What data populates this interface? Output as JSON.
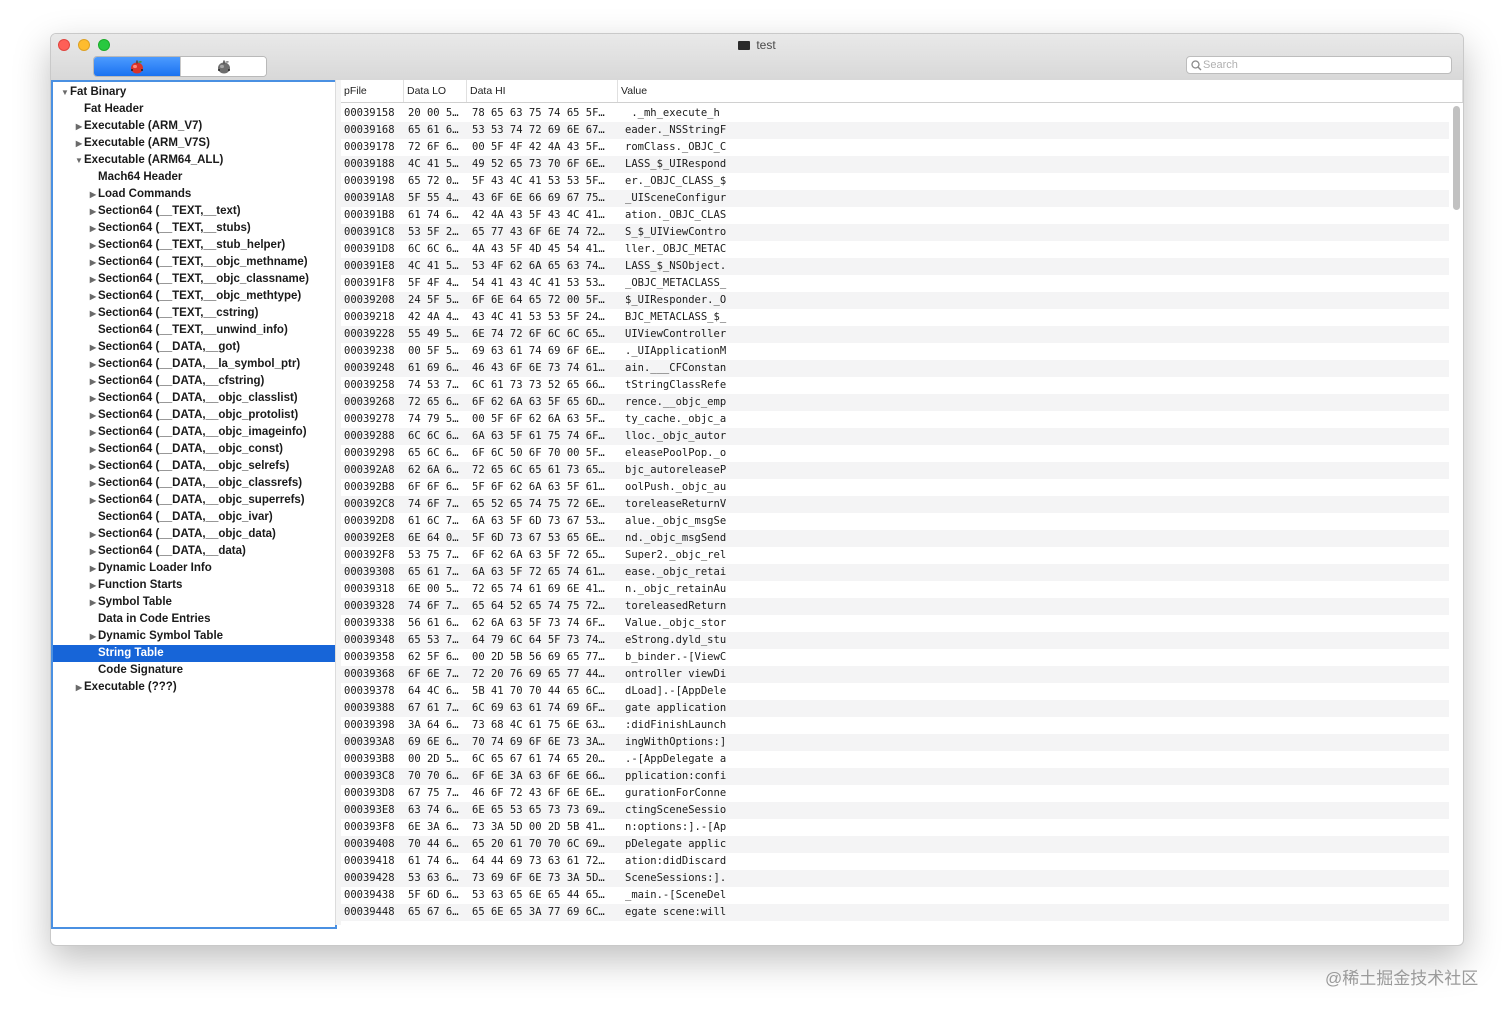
{
  "window": {
    "title": "test",
    "search_placeholder": "Search",
    "segments": [
      {
        "icon": "colored-apple-bug-icon",
        "active": true
      },
      {
        "icon": "gray-apple-bug-icon",
        "active": false
      }
    ]
  },
  "sidebar": {
    "items": [
      {
        "label": "Fat Binary",
        "depth": 0,
        "disclosure": "open"
      },
      {
        "label": "Fat Header",
        "depth": 1,
        "disclosure": "none"
      },
      {
        "label": "Executable  (ARM_V7)",
        "depth": 1,
        "disclosure": "closed"
      },
      {
        "label": "Executable  (ARM_V7S)",
        "depth": 1,
        "disclosure": "closed"
      },
      {
        "label": "Executable  (ARM64_ALL)",
        "depth": 1,
        "disclosure": "open"
      },
      {
        "label": "Mach64 Header",
        "depth": 2,
        "disclosure": "none"
      },
      {
        "label": "Load Commands",
        "depth": 2,
        "disclosure": "closed"
      },
      {
        "label": "Section64 (__TEXT,__text)",
        "depth": 2,
        "disclosure": "closed"
      },
      {
        "label": "Section64 (__TEXT,__stubs)",
        "depth": 2,
        "disclosure": "closed"
      },
      {
        "label": "Section64 (__TEXT,__stub_helper)",
        "depth": 2,
        "disclosure": "closed"
      },
      {
        "label": "Section64 (__TEXT,__objc_methname)",
        "depth": 2,
        "disclosure": "closed"
      },
      {
        "label": "Section64 (__TEXT,__objc_classname)",
        "depth": 2,
        "disclosure": "closed"
      },
      {
        "label": "Section64 (__TEXT,__objc_methtype)",
        "depth": 2,
        "disclosure": "closed"
      },
      {
        "label": "Section64 (__TEXT,__cstring)",
        "depth": 2,
        "disclosure": "closed"
      },
      {
        "label": "Section64 (__TEXT,__unwind_info)",
        "depth": 2,
        "disclosure": "none"
      },
      {
        "label": "Section64 (__DATA,__got)",
        "depth": 2,
        "disclosure": "closed"
      },
      {
        "label": "Section64 (__DATA,__la_symbol_ptr)",
        "depth": 2,
        "disclosure": "closed"
      },
      {
        "label": "Section64 (__DATA,__cfstring)",
        "depth": 2,
        "disclosure": "closed"
      },
      {
        "label": "Section64 (__DATA,__objc_classlist)",
        "depth": 2,
        "disclosure": "closed"
      },
      {
        "label": "Section64 (__DATA,__objc_protolist)",
        "depth": 2,
        "disclosure": "closed"
      },
      {
        "label": "Section64 (__DATA,__objc_imageinfo)",
        "depth": 2,
        "disclosure": "closed"
      },
      {
        "label": "Section64 (__DATA,__objc_const)",
        "depth": 2,
        "disclosure": "closed"
      },
      {
        "label": "Section64 (__DATA,__objc_selrefs)",
        "depth": 2,
        "disclosure": "closed"
      },
      {
        "label": "Section64 (__DATA,__objc_classrefs)",
        "depth": 2,
        "disclosure": "closed"
      },
      {
        "label": "Section64 (__DATA,__objc_superrefs)",
        "depth": 2,
        "disclosure": "closed"
      },
      {
        "label": "Section64 (__DATA,__objc_ivar)",
        "depth": 2,
        "disclosure": "none"
      },
      {
        "label": "Section64 (__DATA,__objc_data)",
        "depth": 2,
        "disclosure": "closed"
      },
      {
        "label": "Section64 (__DATA,__data)",
        "depth": 2,
        "disclosure": "closed"
      },
      {
        "label": "Dynamic Loader Info",
        "depth": 2,
        "disclosure": "closed"
      },
      {
        "label": "Function Starts",
        "depth": 2,
        "disclosure": "closed"
      },
      {
        "label": "Symbol Table",
        "depth": 2,
        "disclosure": "closed"
      },
      {
        "label": "Data in Code Entries",
        "depth": 2,
        "disclosure": "none"
      },
      {
        "label": "Dynamic Symbol Table",
        "depth": 2,
        "disclosure": "closed"
      },
      {
        "label": "String Table",
        "depth": 2,
        "disclosure": "none",
        "selected": true
      },
      {
        "label": "Code Signature",
        "depth": 2,
        "disclosure": "none"
      },
      {
        "label": "Executable  (???)",
        "depth": 1,
        "disclosure": "closed"
      }
    ]
  },
  "table": {
    "columns": [
      "pFile",
      "Data LO",
      "Data HI",
      "Value"
    ],
    "rows": [
      [
        "00039158",
        "20 00 5…",
        "78 65 63 75 74 65 5F…",
        " ._mh_execute_h"
      ],
      [
        "00039168",
        "65 61 6…",
        "53 53 74 72 69 6E 67…",
        "eader._NSStringF"
      ],
      [
        "00039178",
        "72 6F 6…",
        "00 5F 4F 42 4A 43 5F…",
        "romClass._OBJC_C"
      ],
      [
        "00039188",
        "4C 41 5…",
        "49 52 65 73 70 6F 6E…",
        "LASS_$_UIRespond"
      ],
      [
        "00039198",
        "65 72 0…",
        "5F 43 4C 41 53 53 5F…",
        "er._OBJC_CLASS_$"
      ],
      [
        "000391A8",
        "5F 55 4…",
        "43 6F 6E 66 69 67 75…",
        "_UISceneConfigur"
      ],
      [
        "000391B8",
        "61 74 6…",
        "42 4A 43 5F 43 4C 41…",
        "ation._OBJC_CLAS"
      ],
      [
        "000391C8",
        "53 5F 2…",
        "65 77 43 6F 6E 74 72…",
        "S_$_UIViewContro"
      ],
      [
        "000391D8",
        "6C 6C 6…",
        "4A 43 5F 4D 45 54 41…",
        "ller._OBJC_METAC"
      ],
      [
        "000391E8",
        "4C 41 5…",
        "53 4F 62 6A 65 63 74…",
        "LASS_$_NSObject."
      ],
      [
        "000391F8",
        "5F 4F 4…",
        "54 41 43 4C 41 53 53…",
        "_OBJC_METACLASS_"
      ],
      [
        "00039208",
        "24 5F 5…",
        "6F 6E 64 65 72 00 5F…",
        "$_UIResponder._O"
      ],
      [
        "00039218",
        "42 4A 4…",
        "43 4C 41 53 53 5F 24…",
        "BJC_METACLASS_$_"
      ],
      [
        "00039228",
        "55 49 5…",
        "6E 74 72 6F 6C 6C 65…",
        "UIViewController"
      ],
      [
        "00039238",
        "00 5F 5…",
        "69 63 61 74 69 6F 6E…",
        "._UIApplicationM"
      ],
      [
        "00039248",
        "61 69 6…",
        "46 43 6F 6E 73 74 61…",
        "ain.___CFConstan"
      ],
      [
        "00039258",
        "74 53 7…",
        "6C 61 73 73 52 65 66…",
        "tStringClassRefe"
      ],
      [
        "00039268",
        "72 65 6…",
        "6F 62 6A 63 5F 65 6D…",
        "rence.__objc_emp"
      ],
      [
        "00039278",
        "74 79 5…",
        "00 5F 6F 62 6A 63 5F…",
        "ty_cache._objc_a"
      ],
      [
        "00039288",
        "6C 6C 6…",
        "6A 63 5F 61 75 74 6F…",
        "lloc._objc_autor"
      ],
      [
        "00039298",
        "65 6C 6…",
        "6F 6C 50 6F 70 00 5F…",
        "eleasePoolPop._o"
      ],
      [
        "000392A8",
        "62 6A 6…",
        "72 65 6C 65 61 73 65…",
        "bjc_autoreleaseP"
      ],
      [
        "000392B8",
        "6F 6F 6…",
        "5F 6F 62 6A 63 5F 61…",
        "oolPush._objc_au"
      ],
      [
        "000392C8",
        "74 6F 7…",
        "65 52 65 74 75 72 6E…",
        "toreleaseReturnV"
      ],
      [
        "000392D8",
        "61 6C 7…",
        "6A 63 5F 6D 73 67 53…",
        "alue._objc_msgSe"
      ],
      [
        "000392E8",
        "6E 64 0…",
        "5F 6D 73 67 53 65 6E…",
        "nd._objc_msgSend"
      ],
      [
        "000392F8",
        "53 75 7…",
        "6F 62 6A 63 5F 72 65…",
        "Super2._objc_rel"
      ],
      [
        "00039308",
        "65 61 7…",
        "6A 63 5F 72 65 74 61…",
        "ease._objc_retai"
      ],
      [
        "00039318",
        "6E 00 5…",
        "72 65 74 61 69 6E 41…",
        "n._objc_retainAu"
      ],
      [
        "00039328",
        "74 6F 7…",
        "65 64 52 65 74 75 72…",
        "toreleasedReturn"
      ],
      [
        "00039338",
        "56 61 6…",
        "62 6A 63 5F 73 74 6F…",
        "Value._objc_stor"
      ],
      [
        "00039348",
        "65 53 7…",
        "64 79 6C 64 5F 73 74…",
        "eStrong.dyld_stu"
      ],
      [
        "00039358",
        "62 5F 6…",
        "00 2D 5B 56 69 65 77…",
        "b_binder.-[ViewC"
      ],
      [
        "00039368",
        "6F 6E 7…",
        "72 20 76 69 65 77 44…",
        "ontroller viewDi"
      ],
      [
        "00039378",
        "64 4C 6…",
        "5B 41 70 70 44 65 6C…",
        "dLoad].-[AppDele"
      ],
      [
        "00039388",
        "67 61 7…",
        "6C 69 63 61 74 69 6F…",
        "gate application"
      ],
      [
        "00039398",
        "3A 64 6…",
        "73 68 4C 61 75 6E 63…",
        ":didFinishLaunch"
      ],
      [
        "000393A8",
        "69 6E 6…",
        "70 74 69 6F 6E 73 3A…",
        "ingWithOptions:]"
      ],
      [
        "000393B8",
        "00 2D 5…",
        "6C 65 67 61 74 65 20…",
        ".-[AppDelegate a"
      ],
      [
        "000393C8",
        "70 70 6…",
        "6F 6E 3A 63 6F 6E 66…",
        "pplication:confi"
      ],
      [
        "000393D8",
        "67 75 7…",
        "46 6F 72 43 6F 6E 6E…",
        "gurationForConne"
      ],
      [
        "000393E8",
        "63 74 6…",
        "6E 65 53 65 73 73 69…",
        "ctingSceneSessio"
      ],
      [
        "000393F8",
        "6E 3A 6…",
        "73 3A 5D 00 2D 5B 41…",
        "n:options:].-[Ap"
      ],
      [
        "00039408",
        "70 44 6…",
        "65 20 61 70 70 6C 69…",
        "pDelegate applic"
      ],
      [
        "00039418",
        "61 74 6…",
        "64 44 69 73 63 61 72…",
        "ation:didDiscard"
      ],
      [
        "00039428",
        "53 63 6…",
        "73 69 6F 6E 73 3A 5D…",
        "SceneSessions:]."
      ],
      [
        "00039438",
        "5F 6D 6…",
        "53 63 65 6E 65 44 65…",
        "_main.-[SceneDel"
      ],
      [
        "00039448",
        "65 67 6…",
        "65 6E 65 3A 77 69 6C…",
        "egate scene:will"
      ]
    ]
  },
  "watermark": "@稀土掘金技术社区"
}
